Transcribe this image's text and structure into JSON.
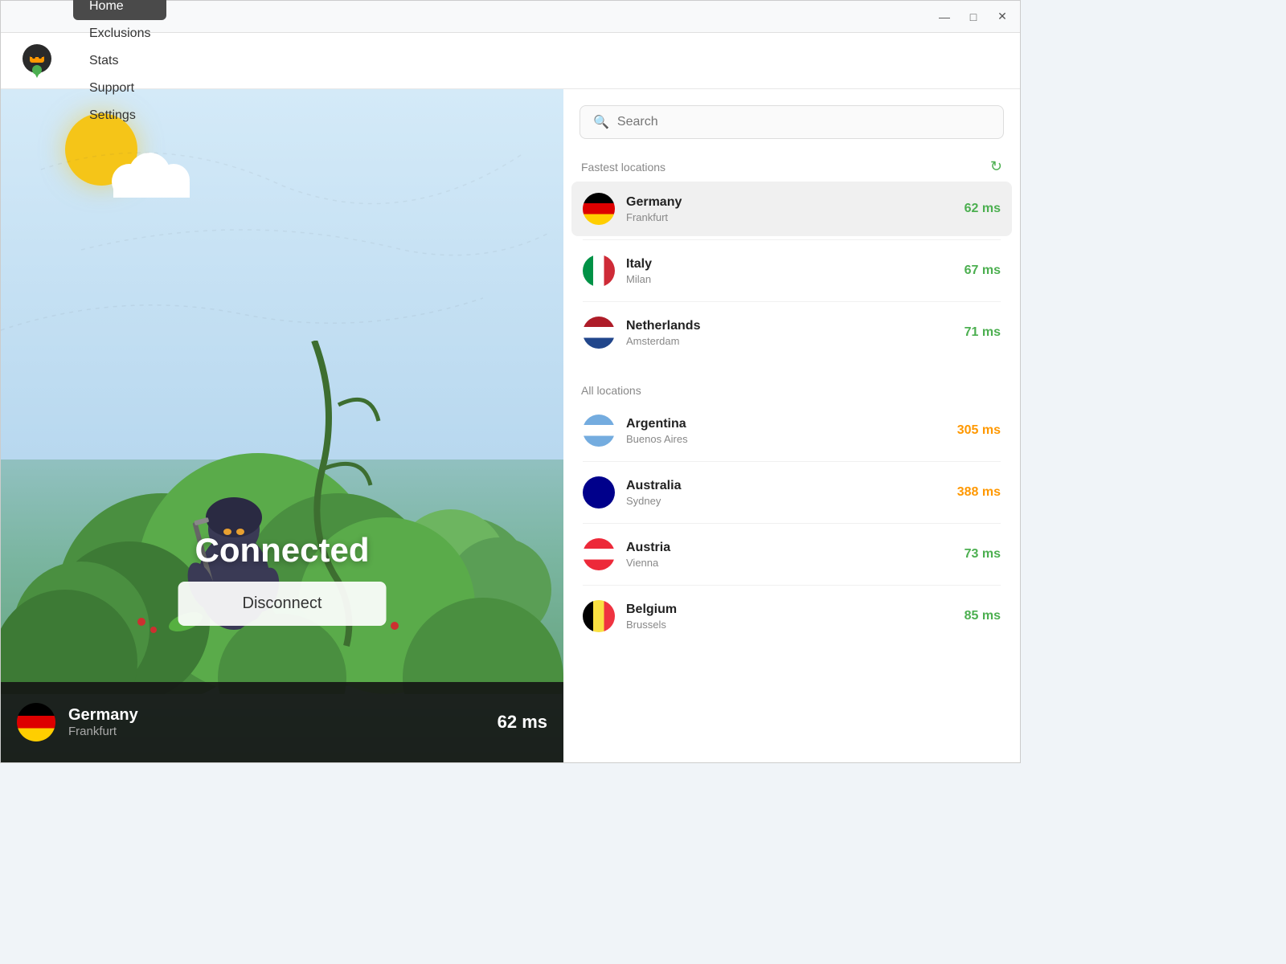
{
  "titlebar": {
    "minimize": "—",
    "maximize": "□",
    "close": "✕"
  },
  "navbar": {
    "logo_alt": "NordVPN Logo",
    "items": [
      {
        "label": "Home",
        "active": true
      },
      {
        "label": "Exclusions",
        "active": false
      },
      {
        "label": "Stats",
        "active": false
      },
      {
        "label": "Support",
        "active": false
      },
      {
        "label": "Settings",
        "active": false
      }
    ]
  },
  "main": {
    "connected_text": "Connected",
    "disconnect_label": "Disconnect",
    "status": {
      "country": "Germany",
      "city": "Frankfurt",
      "latency": "62 ms"
    }
  },
  "search": {
    "placeholder": "Search"
  },
  "fastest_locations": {
    "title": "Fastest locations",
    "items": [
      {
        "country": "Germany",
        "city": "Frankfurt",
        "latency": "62 ms",
        "latency_class": "latency-green",
        "flag_class": "flag-de",
        "flag_emoji": "🇩🇪",
        "selected": true
      },
      {
        "country": "Italy",
        "city": "Milan",
        "latency": "67 ms",
        "latency_class": "latency-green",
        "flag_class": "flag-it",
        "flag_emoji": "🇮🇹",
        "selected": false
      },
      {
        "country": "Netherlands",
        "city": "Amsterdam",
        "latency": "71 ms",
        "latency_class": "latency-green",
        "flag_class": "flag-nl",
        "flag_emoji": "🇳🇱",
        "selected": false
      }
    ]
  },
  "all_locations": {
    "title": "All locations",
    "items": [
      {
        "country": "Argentina",
        "city": "Buenos Aires",
        "latency": "305 ms",
        "latency_class": "latency-orange",
        "flag_class": "flag-ar",
        "flag_emoji": "🇦🇷",
        "selected": false
      },
      {
        "country": "Australia",
        "city": "Sydney",
        "latency": "388 ms",
        "latency_class": "latency-orange",
        "flag_class": "flag-au",
        "flag_emoji": "🇦🇺",
        "selected": false
      },
      {
        "country": "Austria",
        "city": "Vienna",
        "latency": "73 ms",
        "latency_class": "latency-green",
        "flag_class": "flag-at",
        "flag_emoji": "🇦🇹",
        "selected": false
      },
      {
        "country": "Belgium",
        "city": "Brussels",
        "latency": "85 ms",
        "latency_class": "latency-green",
        "flag_class": "flag-be",
        "flag_emoji": "🇧🇪",
        "selected": false
      }
    ]
  }
}
